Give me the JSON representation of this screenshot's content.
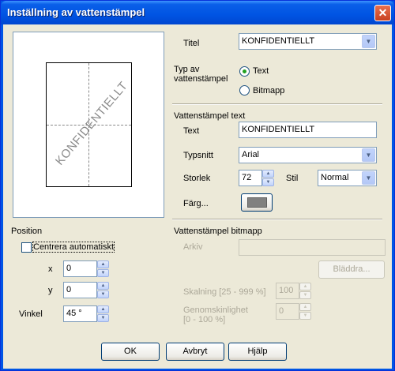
{
  "window": {
    "title": "Inställning av vattenstämpel",
    "close_glyph": "✕"
  },
  "preview": {
    "watermark_text": "KONFIDENTIELLT"
  },
  "titel": {
    "label": "Titel",
    "value": "KONFIDENTIELLT"
  },
  "type": {
    "label_line1": "Typ av",
    "label_line2": "vattenstämpel",
    "options": [
      {
        "label": "Text",
        "selected": true
      },
      {
        "label": "Bitmapp",
        "selected": false
      }
    ]
  },
  "text_section": {
    "heading": "Vattenstämpel text",
    "text_label": "Text",
    "text_value": "KONFIDENTIELLT",
    "font_label": "Typsnitt",
    "font_value": "Arial",
    "size_label": "Storlek",
    "size_value": "72",
    "style_label": "Stil",
    "style_value": "Normal",
    "color_label": "Färg...",
    "color_value": "#808080"
  },
  "position": {
    "heading": "Position",
    "auto_center_label": "Centrera automatiskt",
    "auto_center_checked": false,
    "x_label": "x",
    "x_value": "0",
    "y_label": "y",
    "y_value": "0",
    "angle_label": "Vinkel",
    "angle_value": "45 °"
  },
  "bitmap_section": {
    "heading": "Vattenstämpel bitmapp",
    "file_label": "Arkiv",
    "file_value": "",
    "browse_label": "Bläddra...",
    "scale_label": "Skalning [25 - 999 %]",
    "scale_value": "100",
    "transparency_label_line1": "Genomskinlighet",
    "transparency_label_line2": "[0 - 100 %]",
    "transparency_value": "0"
  },
  "buttons": {
    "ok": "OK",
    "cancel": "Avbryt",
    "help": "Hjälp"
  },
  "icons": {
    "dropdown": "chevron-down-icon",
    "spin_up": "spin-up-icon",
    "spin_down": "spin-down-icon",
    "close": "close-icon"
  }
}
